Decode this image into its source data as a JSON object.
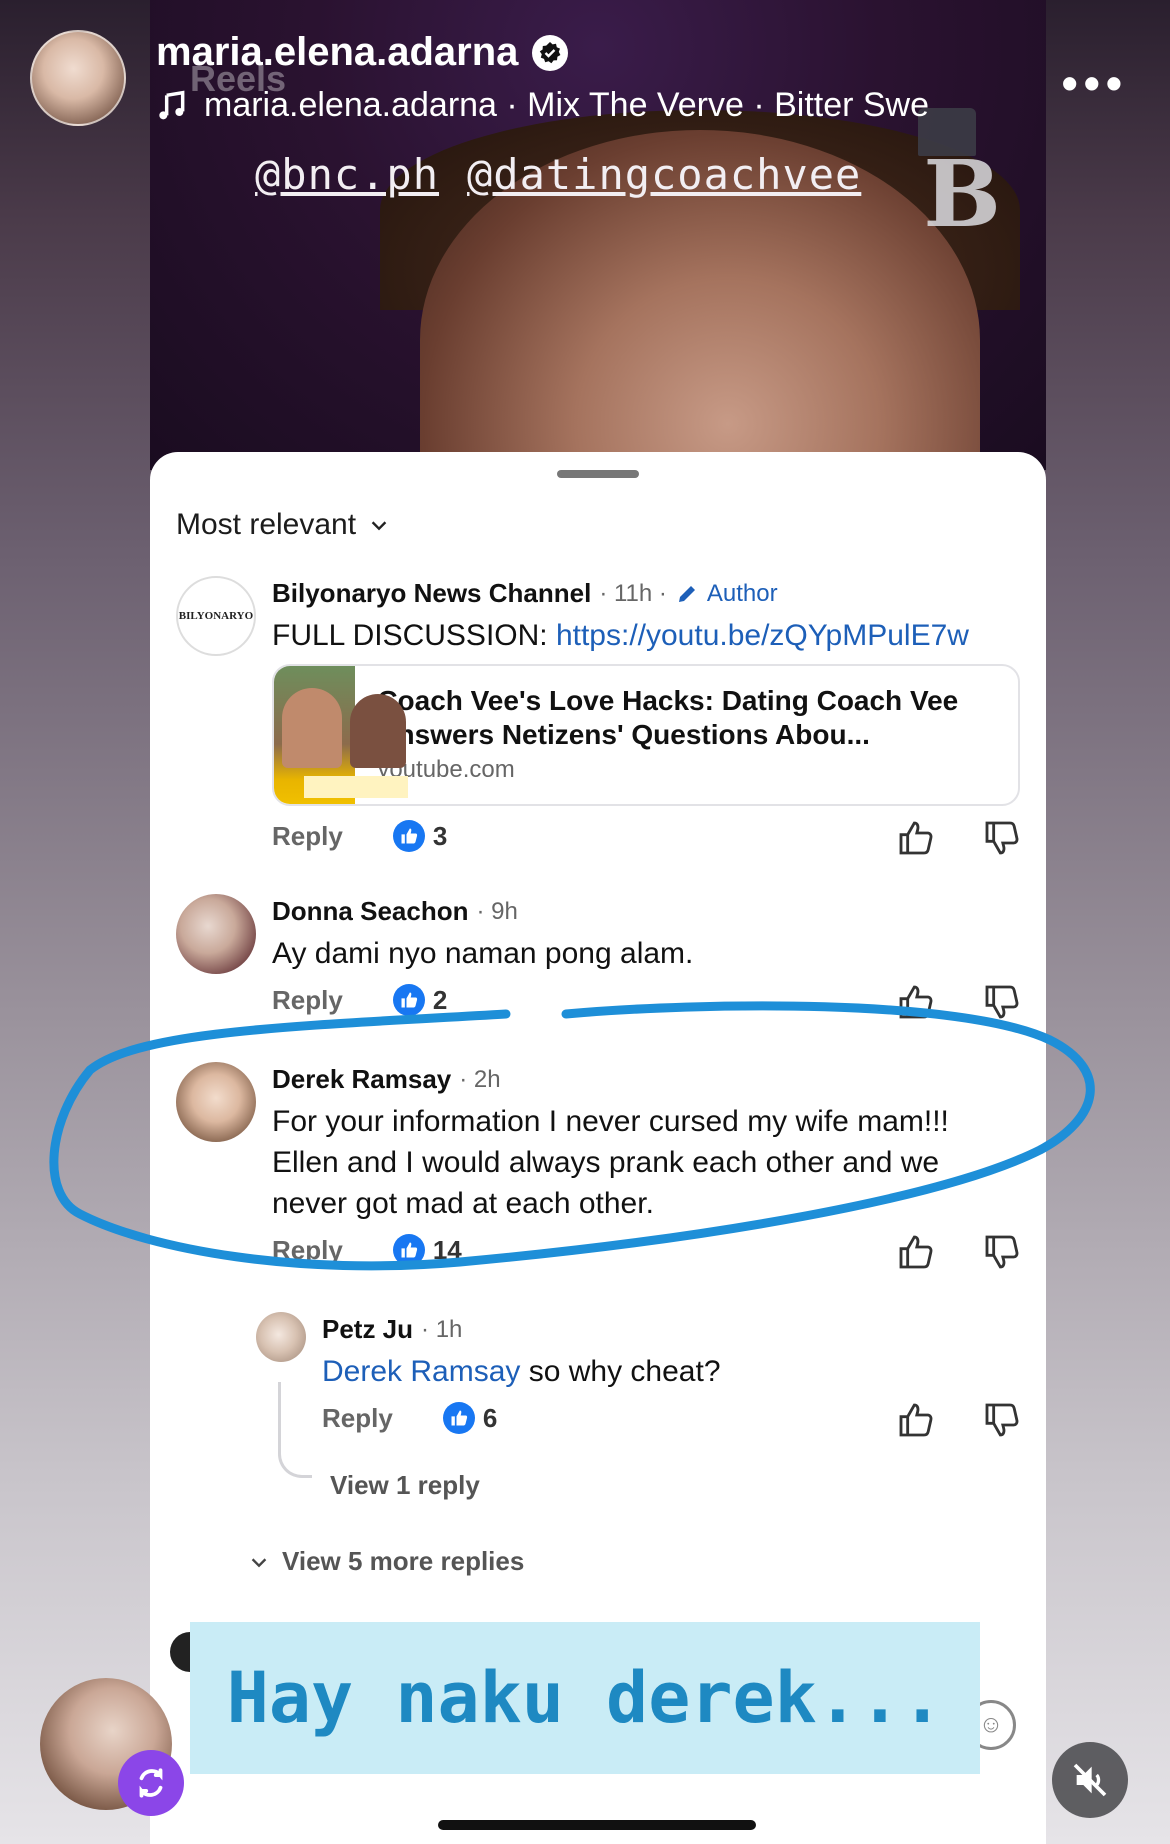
{
  "header": {
    "username": "maria.elena.adarna",
    "music": "maria.elena.adarna · Mix  The Verve · Bitter Swe",
    "faded_title": "Reels"
  },
  "video": {
    "tag_1": "@bnc.ph",
    "tag_2": "@datingcoachvee",
    "logo": "B"
  },
  "sheet": {
    "sort_label": "Most relevant",
    "comments": [
      {
        "name": "Bilyonaryo News Channel",
        "time": "· 11h ·",
        "author_tag": "Author",
        "text_prefix": "FULL DISCUSSION: ",
        "link": "https://youtu.be/zQYpMPulE7w",
        "preview_title": "Coach Vee's Love Hacks: Dating Coach Vee Answers Netizens' Questions Abou...",
        "preview_site": "youtube.com",
        "reply": "Reply",
        "likes": "3"
      },
      {
        "name": "Donna Seachon",
        "time": "· 9h",
        "text": "Ay dami nyo naman pong alam.",
        "reply": "Reply",
        "likes": "2"
      },
      {
        "name": "Derek Ramsay",
        "time": "· 2h",
        "text": "For your information I never cursed my wife mam!!! Ellen and I would always prank each other and we never got mad at each other.",
        "reply": "Reply",
        "likes": "14"
      },
      {
        "name": "Petz Ju",
        "time": "· 1h",
        "mention": "Derek Ramsay",
        "text": " so why cheat?",
        "reply": "Reply",
        "likes": "6",
        "view_reply": "View 1 reply"
      }
    ],
    "more_replies": "View 5 more replies"
  },
  "caption": "Hay naku derek...",
  "colors": {
    "accent_blue": "#1877f2",
    "highlight_stroke": "#1e8fd8",
    "caption_bg": "#c9ecf6",
    "remix_purple": "#8b46e8"
  }
}
